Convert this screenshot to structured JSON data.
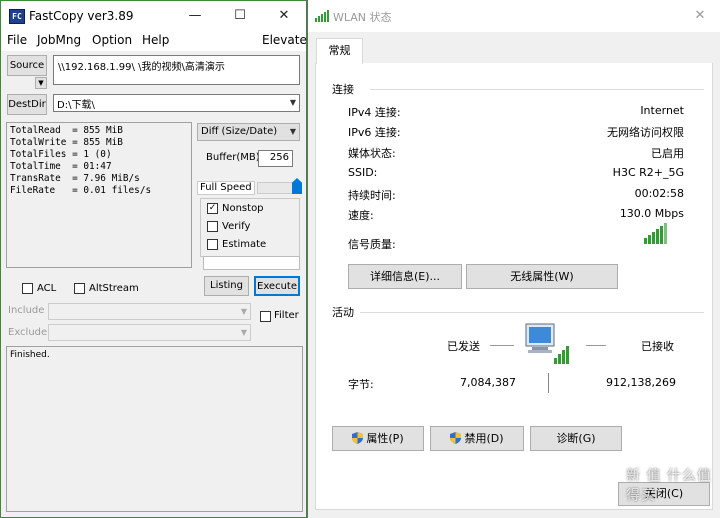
{
  "fastcopy": {
    "title": "FastCopy ver3.89",
    "window_controls": {
      "minimize": "—",
      "maximize": "☐",
      "close": "✕"
    },
    "menu": {
      "file": "File",
      "jobmng": "JobMng",
      "option": "Option",
      "help": "Help",
      "elevate": "Elevate"
    },
    "source_button": "Source",
    "source_path": "\\\\192.168.1.99\\            \\我的视频\\高清演示",
    "destdir_button": "DestDir",
    "dest_path": "D:\\下载\\",
    "stats": {
      "total_read": "TotalRead  = 855 MiB",
      "total_write": "TotalWrite = 855 MiB",
      "total_files": "TotalFiles = 1 (0)",
      "total_time": "TotalTime  = 01:47",
      "trans_rate": "TransRate  = 7.96 MiB/s",
      "file_rate": "FileRate   = 0.01 files/s"
    },
    "mode": "Diff (Size/Date)",
    "buffer_label": "Buffer(MB)",
    "buffer_value": "256",
    "speed_label": "Full Speed",
    "speed_level": 1.0,
    "nonstop_label": "Nonstop",
    "nonstop_checked": "✓",
    "verify_label": "Verify",
    "estimate_label": "Estimate",
    "listing_button": "Listing",
    "execute_button": "Execute",
    "acl_label": "ACL",
    "altstream_label": "AltStream",
    "include_label": "Include",
    "exclude_label": "Exclude",
    "filter_label": "Filter",
    "log_text": "Finished."
  },
  "wlan": {
    "title": "WLAN 状态",
    "window_controls": {
      "close": "✕"
    },
    "tab": "常规",
    "connection_header": "连接",
    "rows": [
      {
        "label": "IPv4 连接:",
        "value": "Internet"
      },
      {
        "label": "IPv6 连接:",
        "value": "无网络访问权限"
      },
      {
        "label": "媒体状态:",
        "value": "已启用"
      },
      {
        "label": "SSID:",
        "value": "H3C R2+_5G"
      },
      {
        "label": "持续时间:",
        "value": "00:02:58"
      },
      {
        "label": "速度:",
        "value": "130.0 Mbps"
      }
    ],
    "signal_label": "信号质量:",
    "details_button": "详细信息(E)...",
    "wireless_props_button": "无线属性(W)",
    "activity_header": "活动",
    "sent_label": "已发送",
    "received_label": "已接收",
    "bytes_label": "字节:",
    "bytes_sent": "7,084,387",
    "bytes_received": "912,138,269",
    "properties_button": "属性(P)",
    "disable_button": "禁用(D)",
    "diagnose_button": "诊断(G)",
    "close_button": "关闭(C)",
    "watermark": "新 值 什么值得买"
  },
  "colors": {
    "signal_green": "#2e9e2e",
    "accent_blue": "#0078d7"
  }
}
